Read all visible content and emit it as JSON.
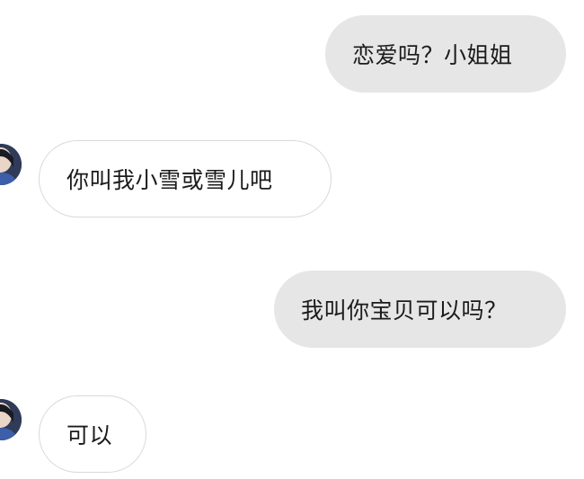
{
  "messages": [
    {
      "side": "sent",
      "text": "恋爱吗？小姐姐"
    },
    {
      "side": "received",
      "text": "你叫我小雪或雪儿吧"
    },
    {
      "side": "sent",
      "text": "我叫你宝贝可以吗？"
    },
    {
      "side": "received",
      "text": "可以"
    }
  ],
  "colors": {
    "sent_bubble": "#e6e6e6",
    "received_bubble_border": "#d9d9d9",
    "text": "#1b1b1b",
    "background": "#ffffff"
  },
  "icons": {
    "contact_avatar": "avatar-icon"
  }
}
